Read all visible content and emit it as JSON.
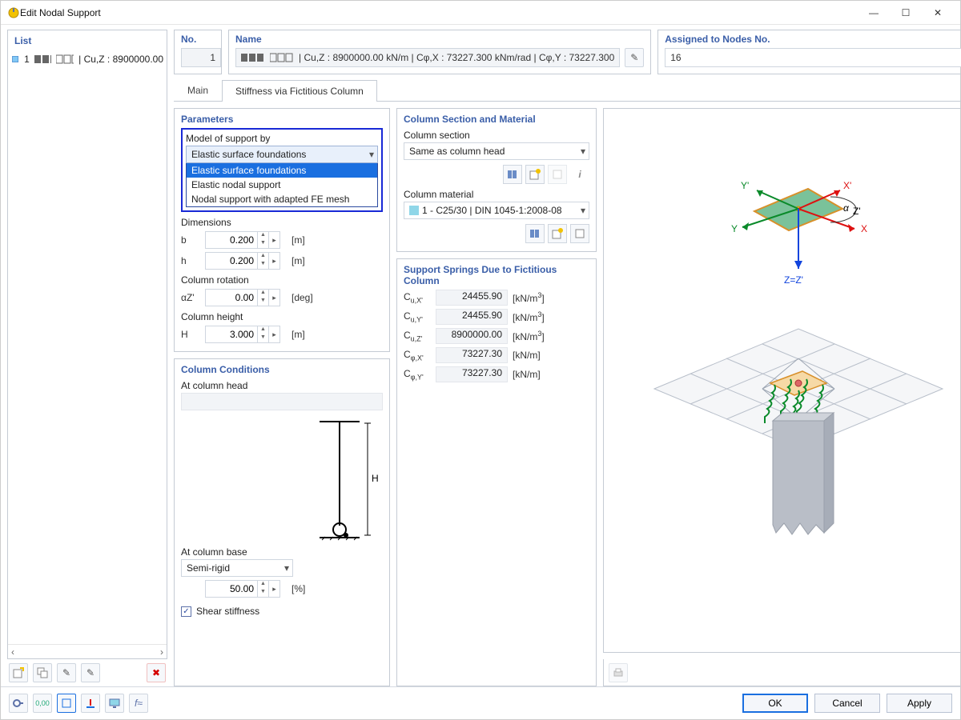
{
  "window": {
    "title": "Edit Nodal Support"
  },
  "list": {
    "title": "List",
    "items": [
      {
        "num": "1",
        "text": "| Cu,Z : 8900000.00"
      }
    ]
  },
  "left_toolbar": {
    "btn_new": "✳",
    "btn_copy": "⎘",
    "btn_del1": "⌫",
    "btn_del2": "⌦",
    "btn_delete": "✖"
  },
  "header": {
    "no_label": "No.",
    "no_value": "1",
    "name_label": "Name",
    "name_value": "| Cu,Z : 8900000.00 kN/m | Cφ,X : 73227.300 kNm/rad | Cφ,Y : 73227.300",
    "edit_icon": "✎",
    "assigned_label": "Assigned to Nodes No.",
    "assigned_value": "16",
    "assigned_clear_icon": "✕"
  },
  "tabs": {
    "main": "Main",
    "stiff": "Stiffness via Fictitious Column"
  },
  "parameters": {
    "title": "Parameters",
    "model_label": "Model of support by",
    "model_selected": "Elastic surface foundations",
    "model_items": [
      "Elastic surface foundations",
      "Elastic nodal support",
      "Nodal support with adapted FE mesh"
    ],
    "dimensions_label": "Dimensions",
    "b_label": "b",
    "b_value": "0.200",
    "b_unit": "[m]",
    "h_label": "h",
    "h_value": "0.200",
    "h_unit": "[m]",
    "rotation_label": "Column rotation",
    "az_label": "αZ'",
    "az_value": "0.00",
    "az_unit": "[deg]",
    "height_label": "Column height",
    "H_label": "H",
    "H_value": "3.000",
    "H_unit": "[m]"
  },
  "conditions": {
    "title": "Column Conditions",
    "head_label": "At column head",
    "base_label": "At column base",
    "base_selected": "Semi-rigid",
    "base_pct_value": "50.00",
    "base_pct_unit": "[%]",
    "shear_label": "Shear stiffness",
    "diagram_H": "H"
  },
  "section": {
    "title": "Column Section and Material",
    "cs_label": "Column section",
    "cs_selected": "Same as column head",
    "material_label": "Column material",
    "material_selected": "1 - C25/30 | DIN 1045-1:2008-08"
  },
  "springs": {
    "title": "Support Springs Due to Fictitious Column",
    "rows": [
      {
        "label": "Cu,X'",
        "value": "24455.90",
        "unit": "[kN/m³]"
      },
      {
        "label": "Cu,Y'",
        "value": "24455.90",
        "unit": "[kN/m³]"
      },
      {
        "label": "Cu,Z'",
        "value": "8900000.00",
        "unit": "[kN/m³]"
      },
      {
        "label": "Cφ,X'",
        "value": "73227.30",
        "unit": "[kN/m]"
      },
      {
        "label": "Cφ,Y'",
        "value": "73227.30",
        "unit": "[kN/m]"
      }
    ]
  },
  "preview": {
    "axes": {
      "x": "X",
      "xp": "X'",
      "y": "Y",
      "yp": "Y'",
      "z": "Z=Z'",
      "az": "αZ'"
    }
  },
  "footer": {
    "ok": "OK",
    "cancel": "Cancel",
    "apply": "Apply"
  }
}
